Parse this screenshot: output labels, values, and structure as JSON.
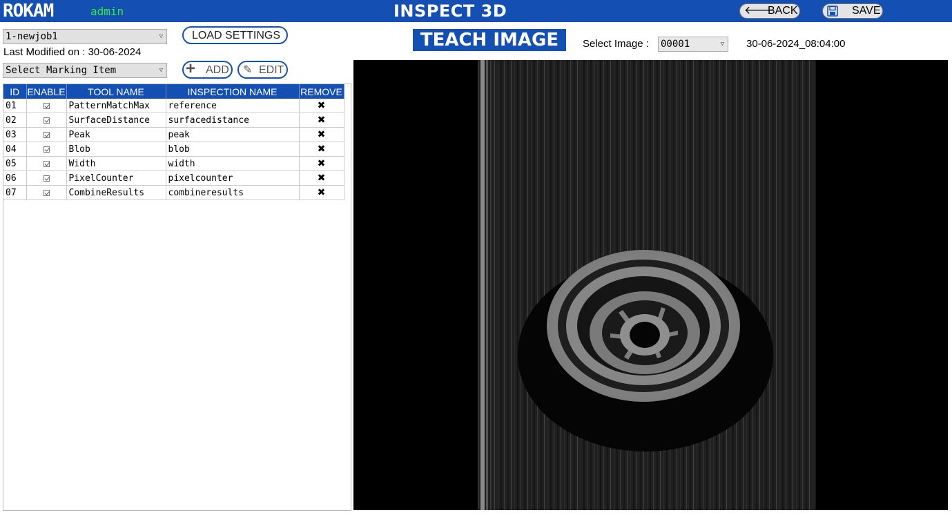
{
  "header": {
    "brand": "ROKAM",
    "user": "admin",
    "title": "INSPECT 3D",
    "back_label": "BACK",
    "save_label": "SAVE"
  },
  "left": {
    "job_select_value": "1-newjob1",
    "last_modified": "Last Modified on : 30-06-2024",
    "load_settings_label": "LOAD SETTINGS",
    "marking_select_value": "Select Marking Item",
    "add_label": "ADD",
    "edit_label": "EDIT"
  },
  "table": {
    "headers": [
      "ID",
      "ENABLE",
      "TOOL NAME",
      "INSPECTION NAME",
      "REMOVE"
    ],
    "rows": [
      {
        "id": "01",
        "enabled": true,
        "tool": "PatternMatchMax",
        "inspection": "reference",
        "remove": "✖"
      },
      {
        "id": "02",
        "enabled": true,
        "tool": "SurfaceDistance",
        "inspection": "surfacedistance",
        "remove": "✖"
      },
      {
        "id": "03",
        "enabled": true,
        "tool": "Peak",
        "inspection": "peak",
        "remove": "✖"
      },
      {
        "id": "04",
        "enabled": true,
        "tool": "Blob",
        "inspection": "blob",
        "remove": "✖"
      },
      {
        "id": "05",
        "enabled": true,
        "tool": "Width",
        "inspection": "width",
        "remove": "✖"
      },
      {
        "id": "06",
        "enabled": true,
        "tool": "PixelCounter",
        "inspection": "pixelcounter",
        "remove": "✖"
      },
      {
        "id": "07",
        "enabled": true,
        "tool": "CombineResults",
        "inspection": "combineresults",
        "remove": "✖"
      }
    ]
  },
  "teach": {
    "title": "TEACH IMAGE",
    "select_label": "Select Image :",
    "image_value": "00001",
    "timestamp": "30-06-2024_08:04:00"
  },
  "icons": {
    "back": "arrow-left-icon",
    "save": "floppy-disk-icon",
    "add": "plus-icon",
    "edit": "pencil-icon",
    "dropdown": "chevron-down-icon",
    "checkbox": "checkbox-checked-icon",
    "remove": "close-x-icon"
  },
  "colors": {
    "header_bg": "#1450b4",
    "user_text": "#33ee33",
    "table_header_bg": "#1450b4",
    "viewer_bg": "#000000"
  }
}
